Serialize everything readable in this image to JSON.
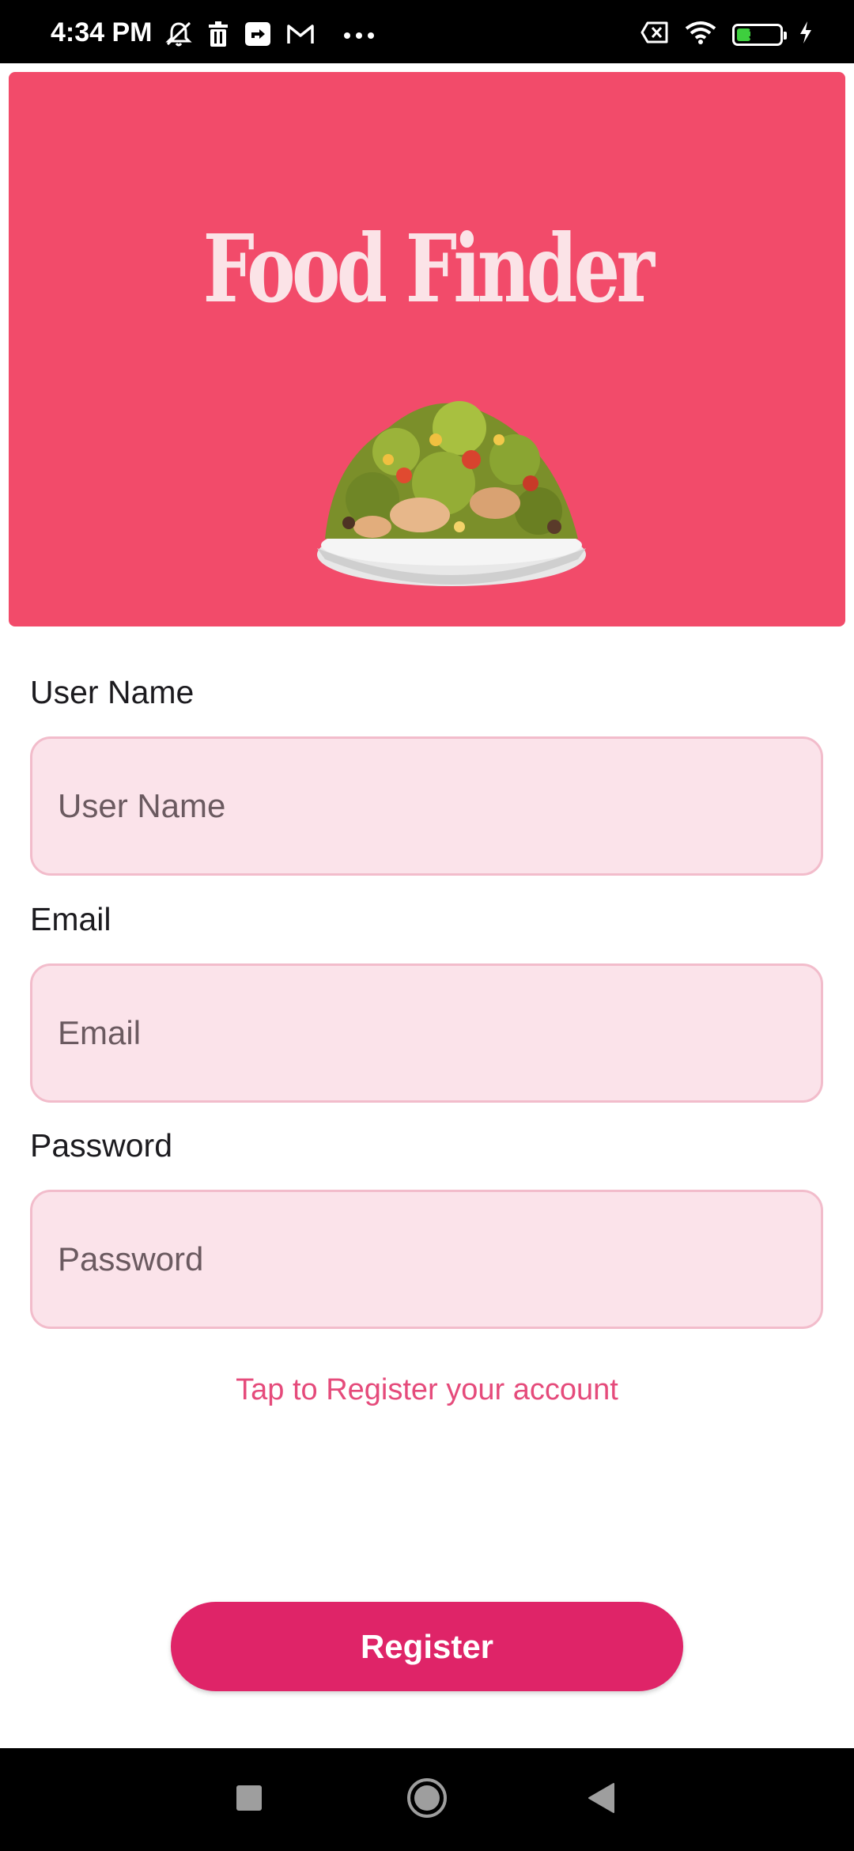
{
  "status_bar": {
    "time": "4:34 PM",
    "battery_level": "33",
    "battery_fraction": 0.33,
    "left_icons": [
      "mute-notification-icon",
      "trash-icon",
      "maps-icon",
      "gmail-icon",
      "more-dots-icon"
    ],
    "right_icons": [
      "sim-off-icon",
      "wifi-icon",
      "battery-icon",
      "charging-bolt-icon"
    ]
  },
  "banner": {
    "title": "Food Finder",
    "background_color": "#f24b6a",
    "image": "salad-bowl-image"
  },
  "form": {
    "username": {
      "label": "User Name",
      "placeholder": "User Name",
      "value": ""
    },
    "email": {
      "label": "Email",
      "placeholder": "Email",
      "value": ""
    },
    "password": {
      "label": "Password",
      "placeholder": "Password",
      "value": ""
    },
    "register_link": "Tap to Register your account",
    "register_button": "Register"
  },
  "colors": {
    "accent": "#df2468",
    "link": "#e54b7b",
    "field_fill": "#fbe3ea",
    "field_border": "#f2bccb"
  },
  "nav_bar": {
    "buttons": [
      "recents-square-icon",
      "home-circle-icon",
      "back-triangle-icon"
    ]
  }
}
